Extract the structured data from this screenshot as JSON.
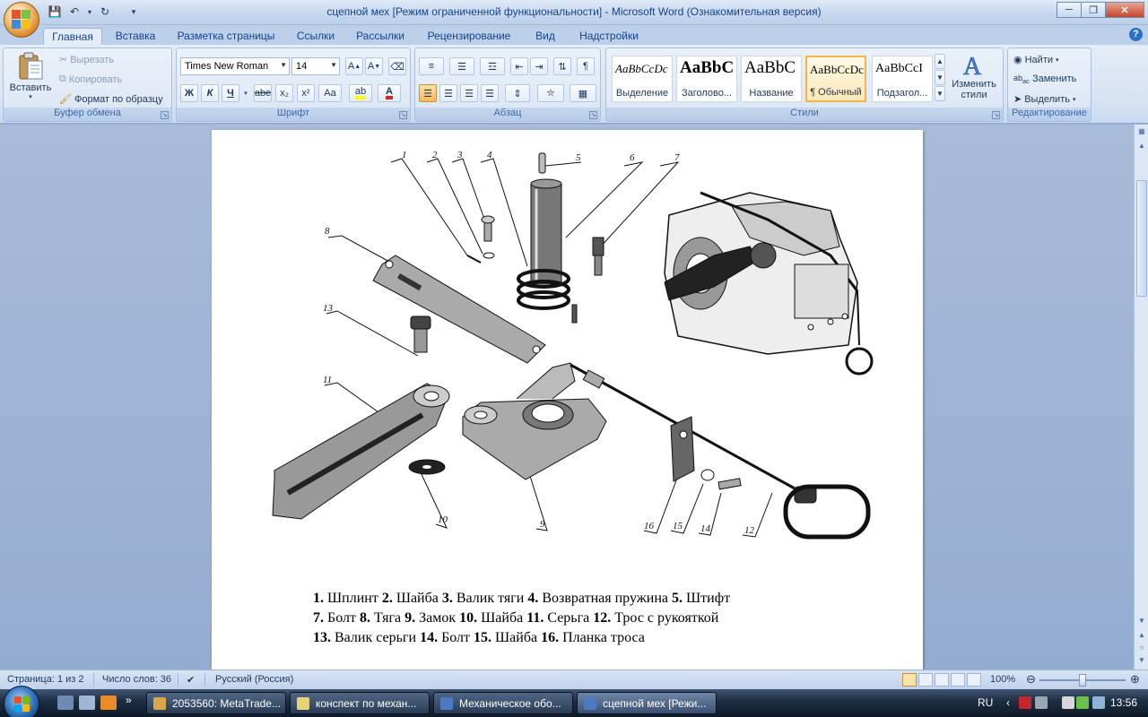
{
  "window": {
    "title": "сцепной мех [Режим ограниченной функциональности] - Microsoft Word (Ознакомительная версия)"
  },
  "tabs": [
    {
      "label": "Главная",
      "active": true
    },
    {
      "label": "Вставка"
    },
    {
      "label": "Разметка страницы"
    },
    {
      "label": "Ссылки"
    },
    {
      "label": "Рассылки"
    },
    {
      "label": "Рецензирование"
    },
    {
      "label": "Вид"
    },
    {
      "label": "Надстройки"
    }
  ],
  "ribbon": {
    "clipboard": {
      "label": "Буфер обмена",
      "paste": "Вставить",
      "cut": "Вырезать",
      "copy": "Копировать",
      "format_painter": "Формат по образцу"
    },
    "font": {
      "label": "Шрифт",
      "font_name": "Times New Roman",
      "font_size": "14",
      "bold": "Ж",
      "italic": "К",
      "underline": "Ч",
      "strike": "abe",
      "subscript": "x₂",
      "superscript": "x²",
      "change_case": "Aa"
    },
    "paragraph": {
      "label": "Абзац"
    },
    "styles": {
      "label": "Стили",
      "items": [
        {
          "sample": "AaBbCcDc",
          "name": "Выделение"
        },
        {
          "sample": "AaBbC",
          "name": "Заголово..."
        },
        {
          "sample": "AaBbC",
          "name": "Название"
        },
        {
          "sample": "AaBbCcDc",
          "name": "¶ Обычный",
          "selected": true
        },
        {
          "sample": "AaBbCcI",
          "name": "Подзагол..."
        }
      ],
      "change_styles": "Изменить стили"
    },
    "editing": {
      "label": "Редактирование",
      "find": "Найти",
      "replace": "Заменить",
      "select": "Выделить"
    }
  },
  "document": {
    "callouts": [
      "1",
      "2",
      "3",
      "4",
      "5",
      "6",
      "7",
      "8",
      "13",
      "11",
      "10",
      "9",
      "16",
      "15",
      "14",
      "12"
    ],
    "caption": [
      [
        {
          "n": "1.",
          "t": " Шплинт "
        },
        {
          "n": "2.",
          "t": " Шайба "
        },
        {
          "n": "3.",
          "t": " Валик тяги "
        },
        {
          "n": "4.",
          "t": " Возвратная пружина "
        },
        {
          "n": "5.",
          "t": " Штифт"
        }
      ],
      [
        {
          "n": "7.",
          "t": " Болт "
        },
        {
          "n": "8.",
          "t": "  Тяга "
        },
        {
          "n": "9.",
          "t": " Замок "
        },
        {
          "n": "10.",
          "t": " Шайба "
        },
        {
          "n": "11.",
          "t": " Серьга "
        },
        {
          "n": "12.",
          "t": " Трос с рукояткой"
        }
      ],
      [
        {
          "n": "13.",
          "t": " Валик серьги "
        },
        {
          "n": "14.",
          "t": " Болт "
        },
        {
          "n": "15.",
          "t": " Шайба "
        },
        {
          "n": "16.",
          "t": " Планка троса"
        }
      ]
    ]
  },
  "status": {
    "page": "Страница: 1 из 2",
    "words": "Число слов: 36",
    "language": "Русский (Россия)",
    "zoom": "100%"
  },
  "taskbar": {
    "tasks": [
      {
        "label": "2053560: MetaTrade..."
      },
      {
        "label": "конспект по механ..."
      },
      {
        "label": "Механическое обо..."
      },
      {
        "label": "сцепной мех [Режи...",
        "active": true
      }
    ],
    "lang": "RU",
    "clock": "13:56"
  }
}
